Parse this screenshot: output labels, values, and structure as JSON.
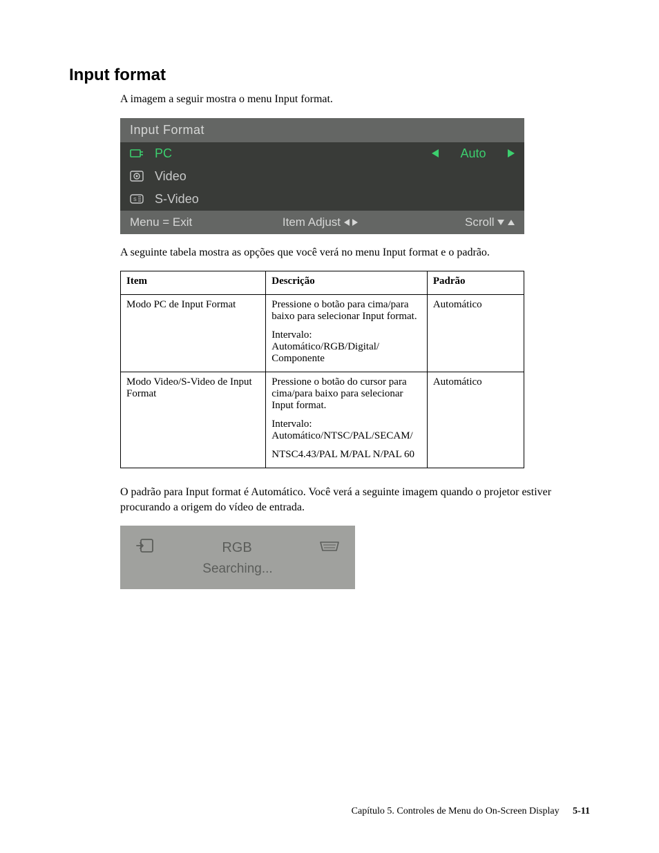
{
  "heading": "Input format",
  "intro": "A imagem a seguir mostra o menu Input format.",
  "osd": {
    "title": "Input Format",
    "rows": [
      {
        "icon": "pc-icon",
        "label": "PC",
        "selected": true,
        "value": "Auto",
        "has_arrows": true
      },
      {
        "icon": "video-icon",
        "label": "Video",
        "selected": false,
        "value": "",
        "has_arrows": false
      },
      {
        "icon": "svideo-icon",
        "label": "S-Video",
        "selected": false,
        "value": "",
        "has_arrows": false
      }
    ],
    "footer": {
      "left": "Menu = Exit",
      "mid": "Item Adjust",
      "right": "Scroll"
    }
  },
  "table_intro": "A seguinte tabela mostra as opções que você verá no menu Input format e o padrão.",
  "table": {
    "headers": {
      "item": "Item",
      "desc": "Descrição",
      "def": "Padrão"
    },
    "rows": [
      {
        "item": "Modo PC de Input Format",
        "desc": [
          "Pressione o botão para cima/para baixo para selecionar Input format.",
          "Intervalo: Automático/RGB/Digital/ Componente"
        ],
        "def": "Automático"
      },
      {
        "item": "Modo Video/S-Video de Input Format",
        "desc": [
          "Pressione o botão do cursor para cima/para baixo para selecionar Input format.",
          "Intervalo: Automático/NTSC/PAL/SECAM/",
          "NTSC4.43/PAL M/PAL N/PAL 60"
        ],
        "def": "Automático"
      }
    ]
  },
  "para_after_table": "O padrão para Input format é Automático. Você verá a seguinte imagem quando o projetor estiver procurando a origem do vídeo de entrada.",
  "search_osd": {
    "mode": "RGB",
    "status": "Searching..."
  },
  "footer": {
    "chapter": "Capítulo 5. Controles de Menu do On-Screen Display",
    "page": "5-11"
  }
}
